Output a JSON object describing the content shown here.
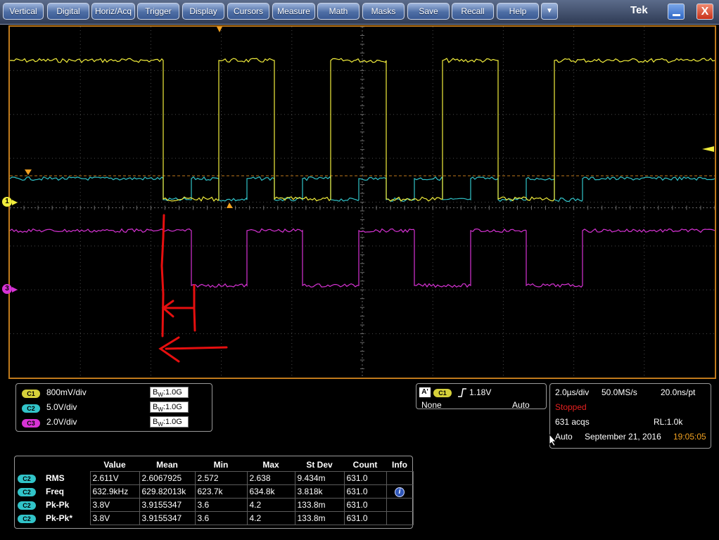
{
  "menu": {
    "items": [
      {
        "label": "Vertical"
      },
      {
        "label": "Digital"
      },
      {
        "label": "Horiz/Acq"
      },
      {
        "label": "Trigger"
      },
      {
        "label": "Display"
      },
      {
        "label": "Cursors"
      },
      {
        "label": "Measure"
      },
      {
        "label": "Math"
      },
      {
        "label": "Masks"
      },
      {
        "label": "Save"
      },
      {
        "label": "Recall"
      },
      {
        "label": "Help"
      }
    ],
    "more_symbol": "▼",
    "brand": "Tek",
    "close_symbol": "X"
  },
  "markers": {
    "ch1_label": "1",
    "ch3_label": "3"
  },
  "colors": {
    "ch1": "#f2ee3c",
    "ch2": "#31c4c9",
    "ch3": "#d732d4",
    "trigger": "#f0a020",
    "annotation": "#e60f0f"
  },
  "channels": [
    {
      "badge": "C1",
      "scale": "800mV/div",
      "bw_prefix": "B",
      "bw_sub": "W",
      "bw_value": ":1.0G",
      "color": "#d6d13a"
    },
    {
      "badge": "C2",
      "scale": "5.0V/div",
      "bw_prefix": "B",
      "bw_sub": "W",
      "bw_value": ":1.0G",
      "color": "#31c4c9"
    },
    {
      "badge": "C3",
      "scale": "2.0V/div",
      "bw_prefix": "B",
      "bw_sub": "W",
      "bw_value": ":1.0G",
      "color": "#d732d4"
    }
  ],
  "trigger": {
    "source_badge": "A'",
    "channel_badge": "C1",
    "level": "1.18V",
    "coupling": "None",
    "mode": "Auto"
  },
  "acquisition": {
    "time_div": "2.0µs/div",
    "sample_rate": "50.0MS/s",
    "resolution": "20.0ns/pt",
    "state": "Stopped",
    "acqs": "631 acqs",
    "record_length": "RL:1.0k",
    "mode": "Auto",
    "date": "September 21, 2016",
    "time": "19:05:05"
  },
  "measurements": {
    "headers": [
      "Value",
      "Mean",
      "Min",
      "Max",
      "St Dev",
      "Count",
      "Info"
    ],
    "rows": [
      {
        "badge": "C2",
        "name": "RMS",
        "value": "2.611V",
        "mean": "2.6067925",
        "min": "2.572",
        "max": "2.638",
        "stdev": "9.434m",
        "count": "631.0",
        "info": ""
      },
      {
        "badge": "C2",
        "name": "Freq",
        "value": "632.9kHz",
        "mean": "629.82013k",
        "min": "623.7k",
        "max": "634.8k",
        "stdev": "3.818k",
        "count": "631.0",
        "info": "i"
      },
      {
        "badge": "C2",
        "name": "Pk-Pk",
        "value": "3.8V",
        "mean": "3.9155347",
        "min": "3.6",
        "max": "4.2",
        "stdev": "133.8m",
        "count": "631.0",
        "info": ""
      },
      {
        "badge": "C2",
        "name": "Pk-Pk*",
        "value": "3.8V",
        "mean": "3.9155347",
        "min": "3.6",
        "max": "4.2",
        "stdev": "133.8m",
        "count": "631.0",
        "info": ""
      }
    ]
  }
}
